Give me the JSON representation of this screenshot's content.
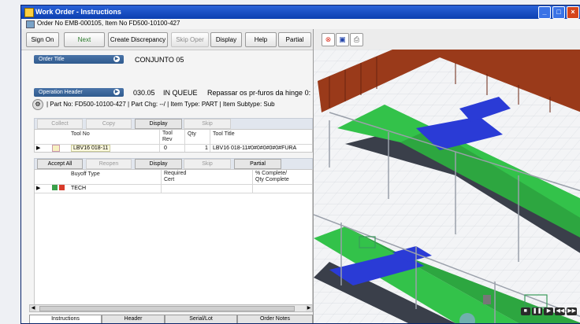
{
  "window": {
    "title": "Work Order - Instructions",
    "subtitle": "Order No  EMB-000105, Item No  FD500-10100-427"
  },
  "toolbar": {
    "sign_on": "Sign On",
    "next": "Next",
    "create_discrepancy": "Create Discrepancy",
    "skip_oper": "Skip Oper",
    "display": "Display",
    "help": "Help",
    "partial": "Partial"
  },
  "order_title": {
    "label": "Order Title",
    "value": "CONJUNTO 05"
  },
  "operation_header": {
    "label": "Operation Header",
    "op": "030.05",
    "status": "IN QUEUE",
    "desc": "Repassar os pr-furos da hinge 0:"
  },
  "part_line": "| Part No: FD500-10100-427 | Part Chg: --/ | Item Type: PART | Item Subtype: Sub",
  "tool_tabs": [
    "Collect",
    "Copy",
    "Display",
    "Skip"
  ],
  "tool_grid": {
    "headers": {
      "tool_no": "Tool No",
      "tool_rev": "Tool\nRev",
      "qty": "Qty",
      "tool_title": "Tool Title"
    },
    "rows": [
      {
        "tool_no": "LBV16 018-11",
        "tool_rev": "0",
        "qty": "1",
        "tool_title": "LBV16 018-11#0#0#0#0#0#FURA"
      }
    ]
  },
  "buyoff_tabs": [
    "Accept All",
    "Reopen",
    "Display",
    "Skip",
    "Partial"
  ],
  "buyoff_grid": {
    "headers": {
      "buyoff_type": "Buyoff Type",
      "required_cert": "Required\nCert",
      "pct": "% Complete/\nQty Complete"
    },
    "rows": [
      {
        "buyoff_type": "TECH"
      }
    ]
  },
  "bottom_tabs": [
    "Instructions",
    "Header",
    "Serial/Lot",
    "Order Notes"
  ],
  "viewer": {
    "icons": [
      "close-red-icon",
      "camera-view-icon",
      "print-icon"
    ]
  },
  "colors": {
    "title_blue": "#0b3fb0",
    "section_blue": "#2f5a8e",
    "conveyor_green": "#33c24a",
    "conveyor_blue": "#2a3bd6",
    "wall_brown": "#9a3a1a"
  }
}
